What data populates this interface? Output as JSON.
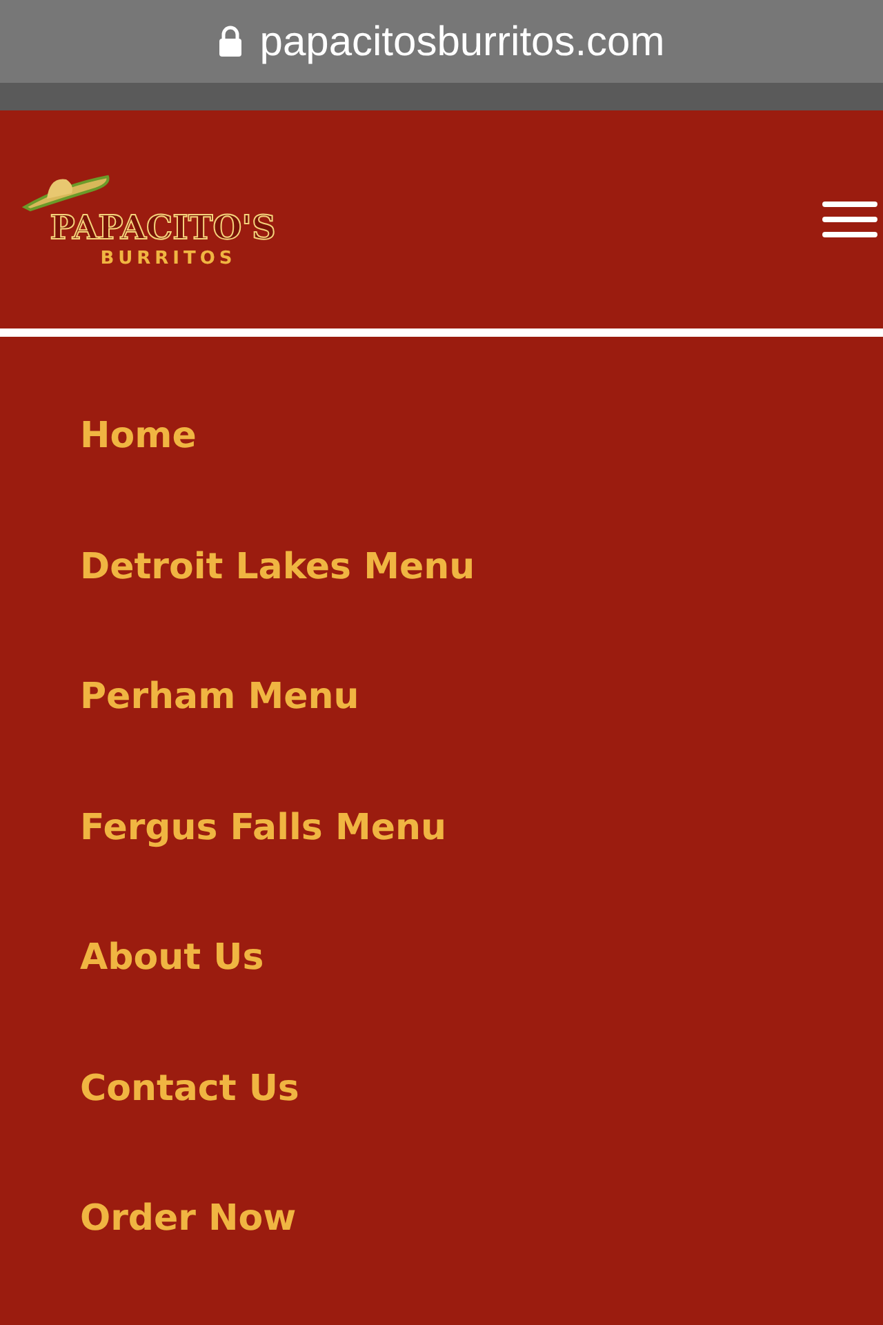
{
  "address_bar": {
    "url": "papacitosburritos.com"
  },
  "header": {
    "logo": {
      "line_1": "PAPACITO'S",
      "line_2": "BURRITOS"
    }
  },
  "menu": {
    "items": [
      {
        "label": "Home"
      },
      {
        "label": "Detroit Lakes Menu"
      },
      {
        "label": "Perham Menu"
      },
      {
        "label": "Fergus Falls Menu"
      },
      {
        "label": "About Us"
      },
      {
        "label": "Contact Us"
      },
      {
        "label": "Order Now"
      }
    ]
  }
}
